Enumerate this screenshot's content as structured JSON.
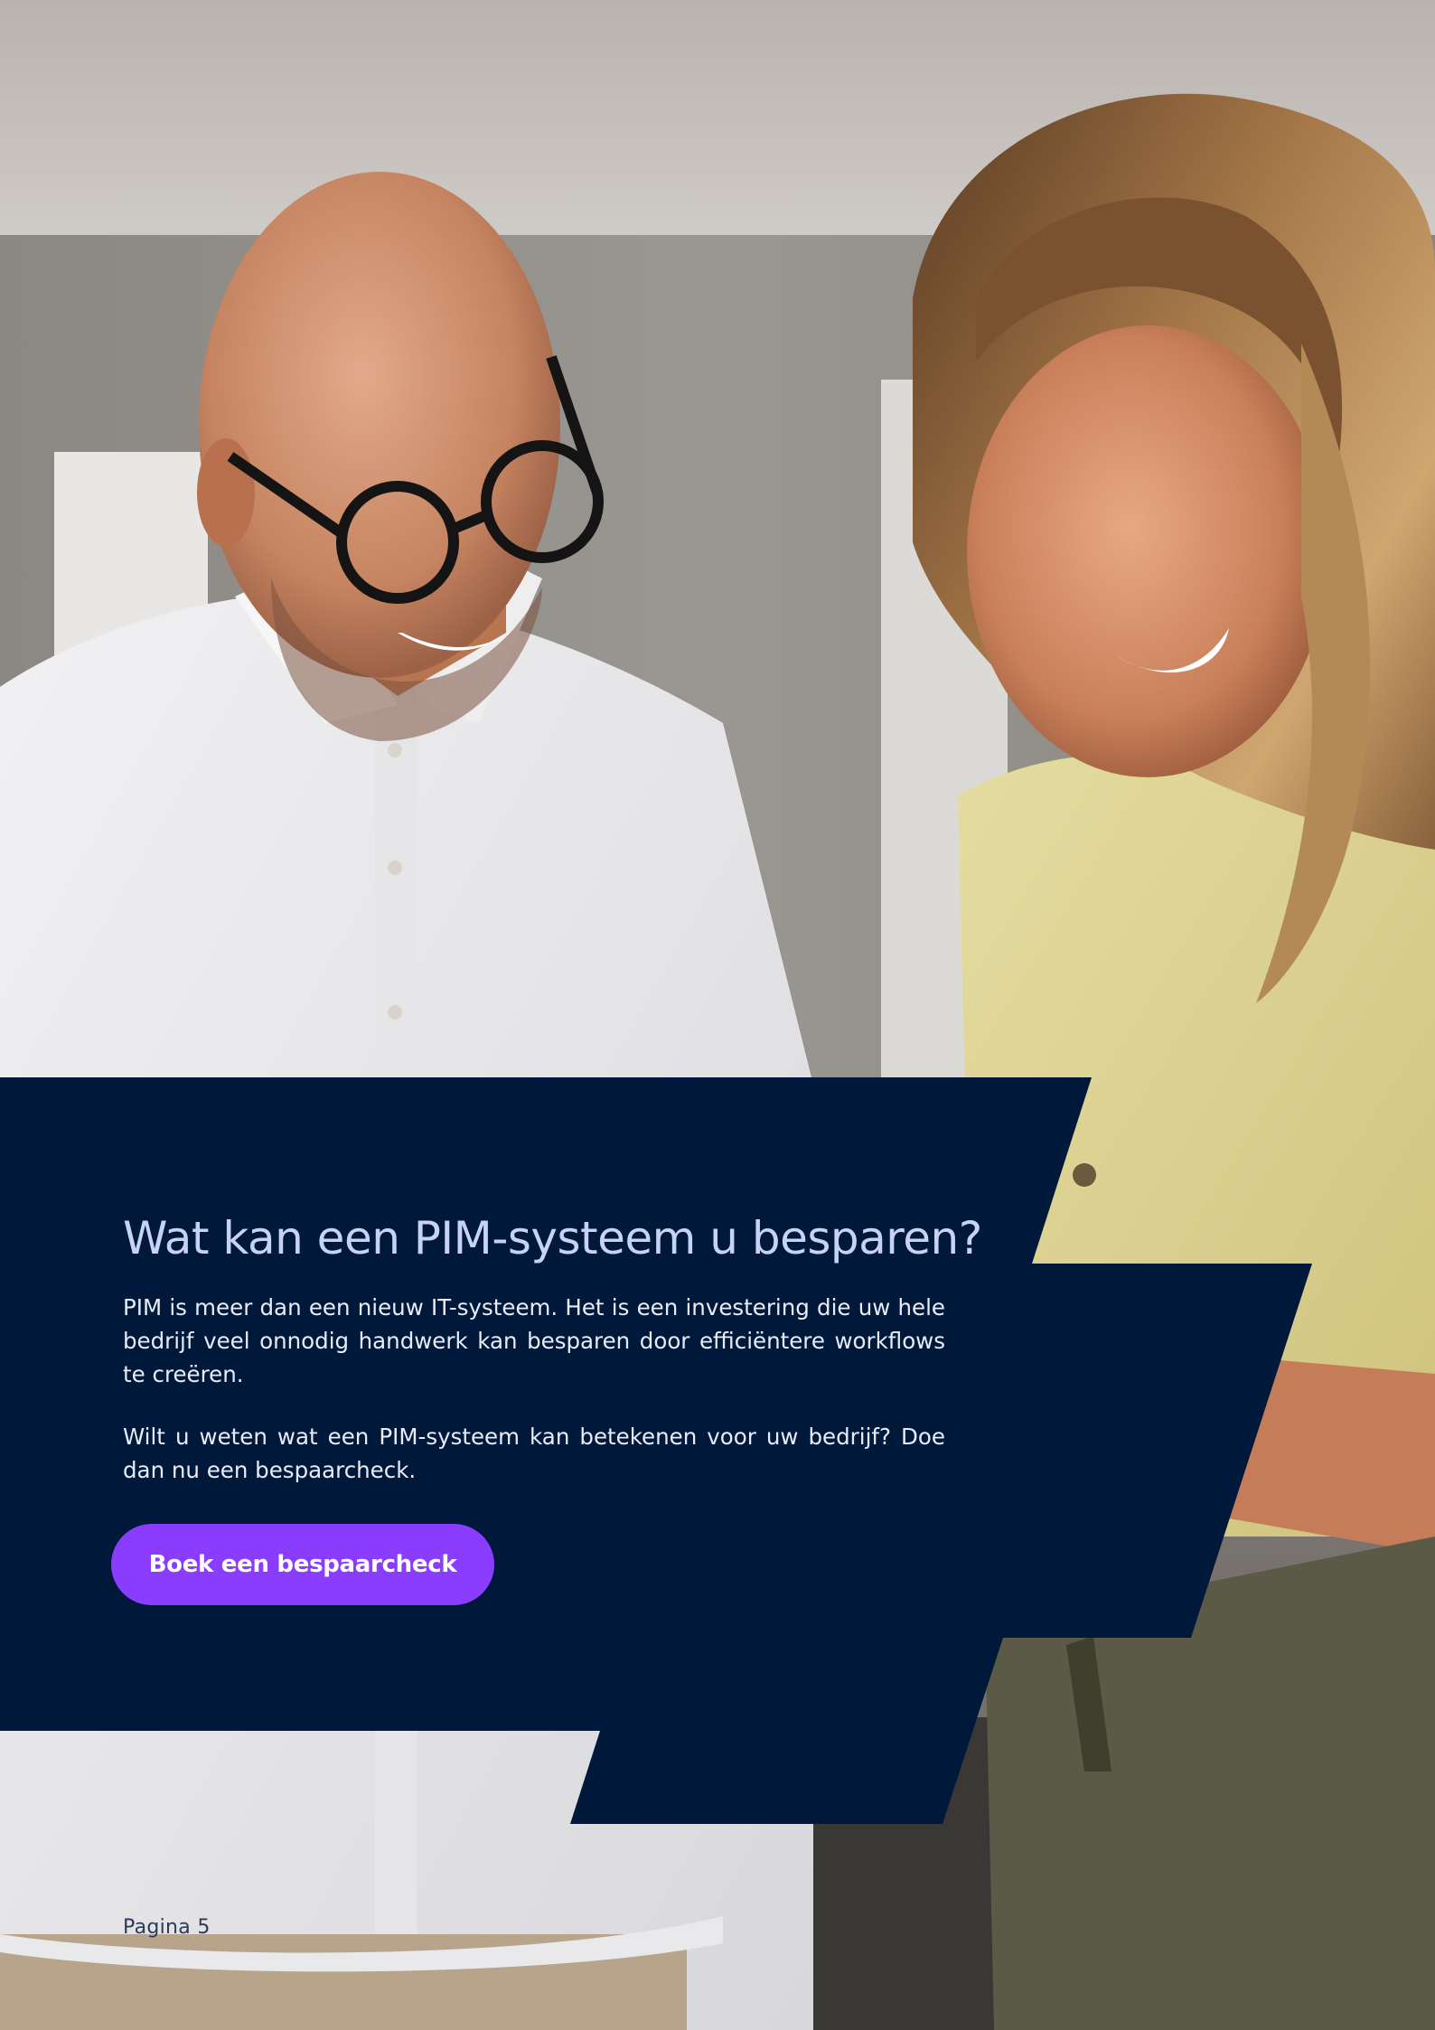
{
  "heading": "Wat kan een PIM-systeem u besparen?",
  "paragraphs": [
    "PIM is meer dan een nieuw IT-systeem. Het is een investering die uw hele bedrijf veel onnodig handwerk kan besparen door efficiëntere workflows te creëren.",
    "Wilt u weten wat een PIM-systeem kan betekenen voor uw bedrijf? Doe dan nu een bespaarcheck."
  ],
  "cta_label": "Boek een bespaarcheck",
  "page_label": "Pagina 5",
  "colors": {
    "navy_panel": "#00183a",
    "heading": "#c7d3f4",
    "button": "#8b3dff",
    "button_text": "#ffffff"
  }
}
